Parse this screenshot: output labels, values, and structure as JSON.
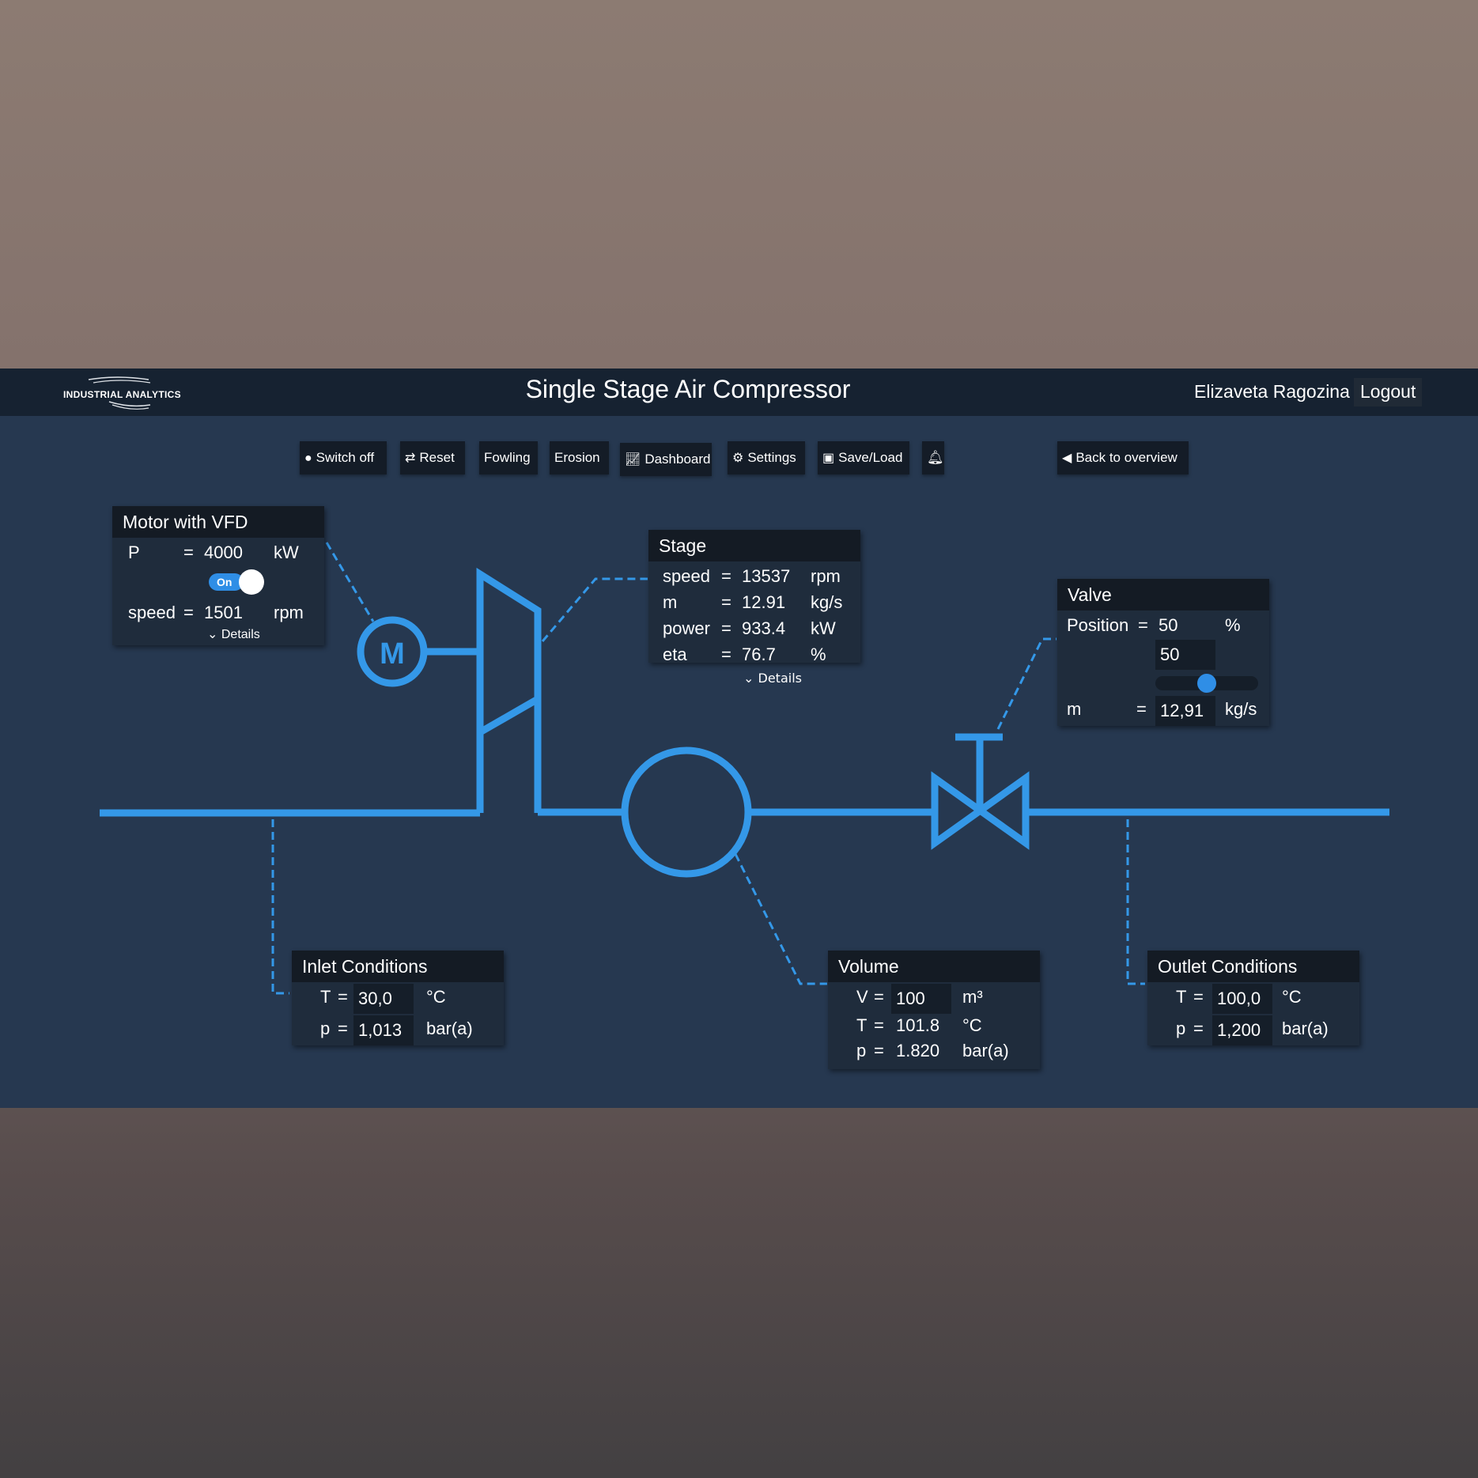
{
  "header": {
    "logo_text": "INDUSTRIAL ANALYTICS",
    "title": "Single Stage Air Compressor",
    "user_name": "Elizaveta Ragozina",
    "logout_label": "Logout"
  },
  "toolbar": {
    "switch_off": "Switch off",
    "reset": "Reset",
    "fowling": "Fowling",
    "erosion": "Erosion",
    "dashboard": "Dashboard",
    "settings": "Settings",
    "save_load": "Save/Load",
    "back": "Back to overview"
  },
  "motor": {
    "title": "Motor with VFD",
    "p_label": "P",
    "eq": "=",
    "p_value": "4000",
    "p_unit": "kW",
    "toggle_label": "On",
    "speed_label": "speed",
    "speed_value": "1501",
    "speed_unit": "rpm",
    "details": "Details",
    "symbol": "M"
  },
  "stage": {
    "title": "Stage",
    "rows": [
      {
        "label": "speed",
        "eq": "=",
        "value": "13537",
        "unit": "rpm"
      },
      {
        "label": "m",
        "eq": "=",
        "value": "12.91",
        "unit": "kg/s"
      },
      {
        "label": "power",
        "eq": "=",
        "value": "933.4",
        "unit": "kW"
      },
      {
        "label": "eta",
        "eq": "=",
        "value": "76.7",
        "unit": "%"
      }
    ],
    "details": "Details"
  },
  "valve": {
    "title": "Valve",
    "position_label": "Position",
    "eq": "=",
    "position_value": "50",
    "position_unit": "%",
    "position_input": "50",
    "slider_fraction": 0.5,
    "m_label": "m",
    "m_value": "12,91",
    "m_unit": "kg/s"
  },
  "inlet": {
    "title": "Inlet Conditions",
    "t_label": "T",
    "eq": "=",
    "t_value": "30,0",
    "t_unit": "°C",
    "p_label": "p",
    "p_value": "1,013",
    "p_unit": "bar(a)"
  },
  "volume": {
    "title": "Volume",
    "v_label": "V",
    "eq": "=",
    "v_value": "100",
    "v_unit": "m³",
    "t_label": "T",
    "t_value": "101.8",
    "t_unit": "°C",
    "p_label": "p",
    "p_value": "1.820",
    "p_unit": "bar(a)"
  },
  "outlet": {
    "title": "Outlet Conditions",
    "t_label": "T",
    "eq": "=",
    "t_value": "100,0",
    "t_unit": "°C",
    "p_label": "p",
    "p_value": "1,200",
    "p_unit": "bar(a)"
  },
  "colors": {
    "accent": "#3498e8",
    "panel": "#1f2c3c",
    "panel_header": "#141b24",
    "background": "#263850",
    "topbar": "#162231"
  }
}
